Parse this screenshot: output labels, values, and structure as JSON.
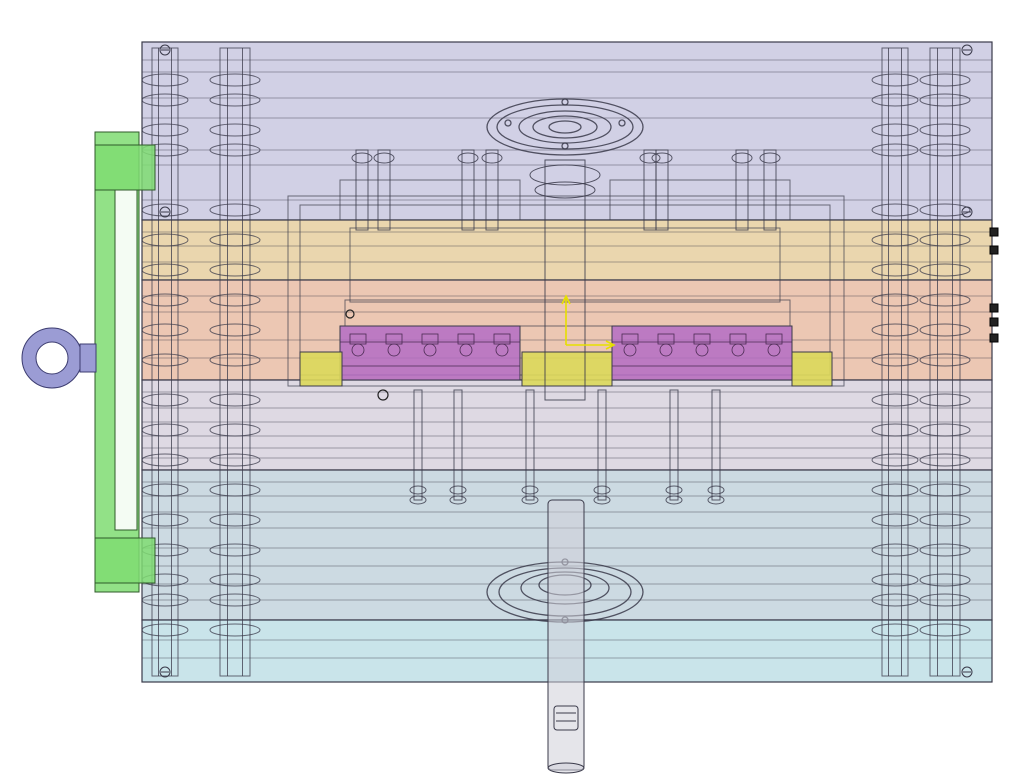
{
  "viewport": {
    "background": "#ffffff",
    "outline_color": "#3a3a4a",
    "component_colors": {
      "top_clamp_plate": "#c9c8e0",
      "cavity_plate_upper": "#e6cfa0",
      "cavity_plate_lower": "#e9bda6",
      "core_plate": "#d8d2de",
      "support_block_region": "#c3d4dd",
      "bottom_clamp_plate": "#bfdfe6",
      "cavity_inserts": "#b46cc4",
      "slide_blocks": "#dcd85a",
      "latch_bracket": "#7fdc72",
      "eye_bolt": "#9b9cd4",
      "sprue_bushing": "#cfcfd8",
      "coordinate_triad": "#e6e000"
    },
    "icons": [
      "coordinate-axis-triad-icon",
      "eye-bolt-icon"
    ]
  }
}
